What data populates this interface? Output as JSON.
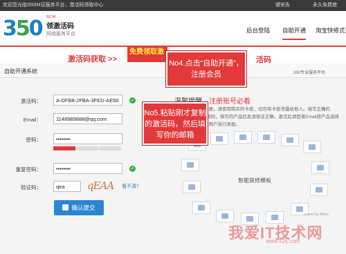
{
  "topbar": {
    "welcome": "欢迎您光临350IM证服务平台，激活码领取中心",
    "right1": "键安告",
    "right2": "永久免费使"
  },
  "logo": {
    "number_prefix": "3",
    "number_o": "5",
    "number_suffix": "0",
    "beta": "BETA!",
    "title": "领激活码",
    "subtitle": "网络服务平台"
  },
  "nav": {
    "items": [
      "后台登陆",
      "自助开通",
      "淘宝快修式开"
    ]
  },
  "banner": {
    "get_code": "激活码获取 >>",
    "free_button": "免费领取激",
    "right_text": "活码"
  },
  "section": {
    "tab_title": "自助开通系统",
    "slogan": "350专业服务平台"
  },
  "form": {
    "code_label": "激活码：",
    "code_value": "A-DFB8-2FBA-3FED-AE50",
    "email_label": "Email：",
    "email_value": "1148989888@qq.com",
    "password_label": "密码：",
    "password_value": "••••••••",
    "confirm_label": "重复密码：",
    "confirm_value": "••••••••",
    "captcha_label": "验证码：",
    "captcha_value": "qea",
    "captcha_image_text": "qEAA",
    "refresh_link": "看不清？",
    "submit_label": "确认提交"
  },
  "tips": {
    "title_prefix": "温馨提醒，",
    "title_suffix": "注册账号必看",
    "body": "卡激活并完成注册，请使用购买的卡密，切勿将卡密泄露给他人。填写正确的Email以便找回密码，填写的产品信息请保证正确，激活后请登录Email按产品选择操作，查找均由用户自行承担。"
  },
  "ring": {
    "label": "智能装修模板",
    "powered": "power by 350cc"
  },
  "callouts": {
    "step4": "No4.点击“自助开通”，注册会员",
    "step5": "No5.粘贴刚才复制的激活码，然后填写你的邮箱"
  },
  "watermark": {
    "text": "我爱IT技术网",
    "url": "www.52ij.com"
  },
  "colors": {
    "accent_red": "#e2393a",
    "brand_blue": "#1c7fc4",
    "success_green": "#3cae3c"
  }
}
